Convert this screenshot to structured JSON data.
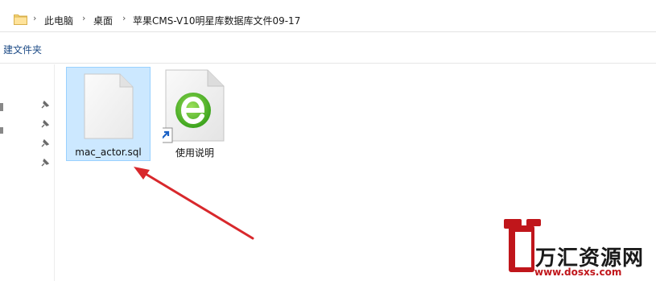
{
  "breadcrumb": {
    "items": [
      "此电脑",
      "桌面",
      "苹果CMS-V10明星库数据库文件09-17"
    ]
  },
  "toolbar": {
    "new_folder_label": "建文件夹"
  },
  "files": [
    {
      "name": "mac_actor.sql",
      "icon": "blank-file-icon",
      "selected": true
    },
    {
      "name": "使用说明",
      "icon": "browser-shortcut-icon",
      "selected": false
    }
  ],
  "watermark": {
    "brand": "万汇资源网",
    "url": "www.dosxs.com",
    "brand_color": "#c0161b"
  },
  "colors": {
    "selection_bg": "#cce8ff",
    "selection_border": "#99d1ff",
    "arrow": "#d8282c"
  }
}
